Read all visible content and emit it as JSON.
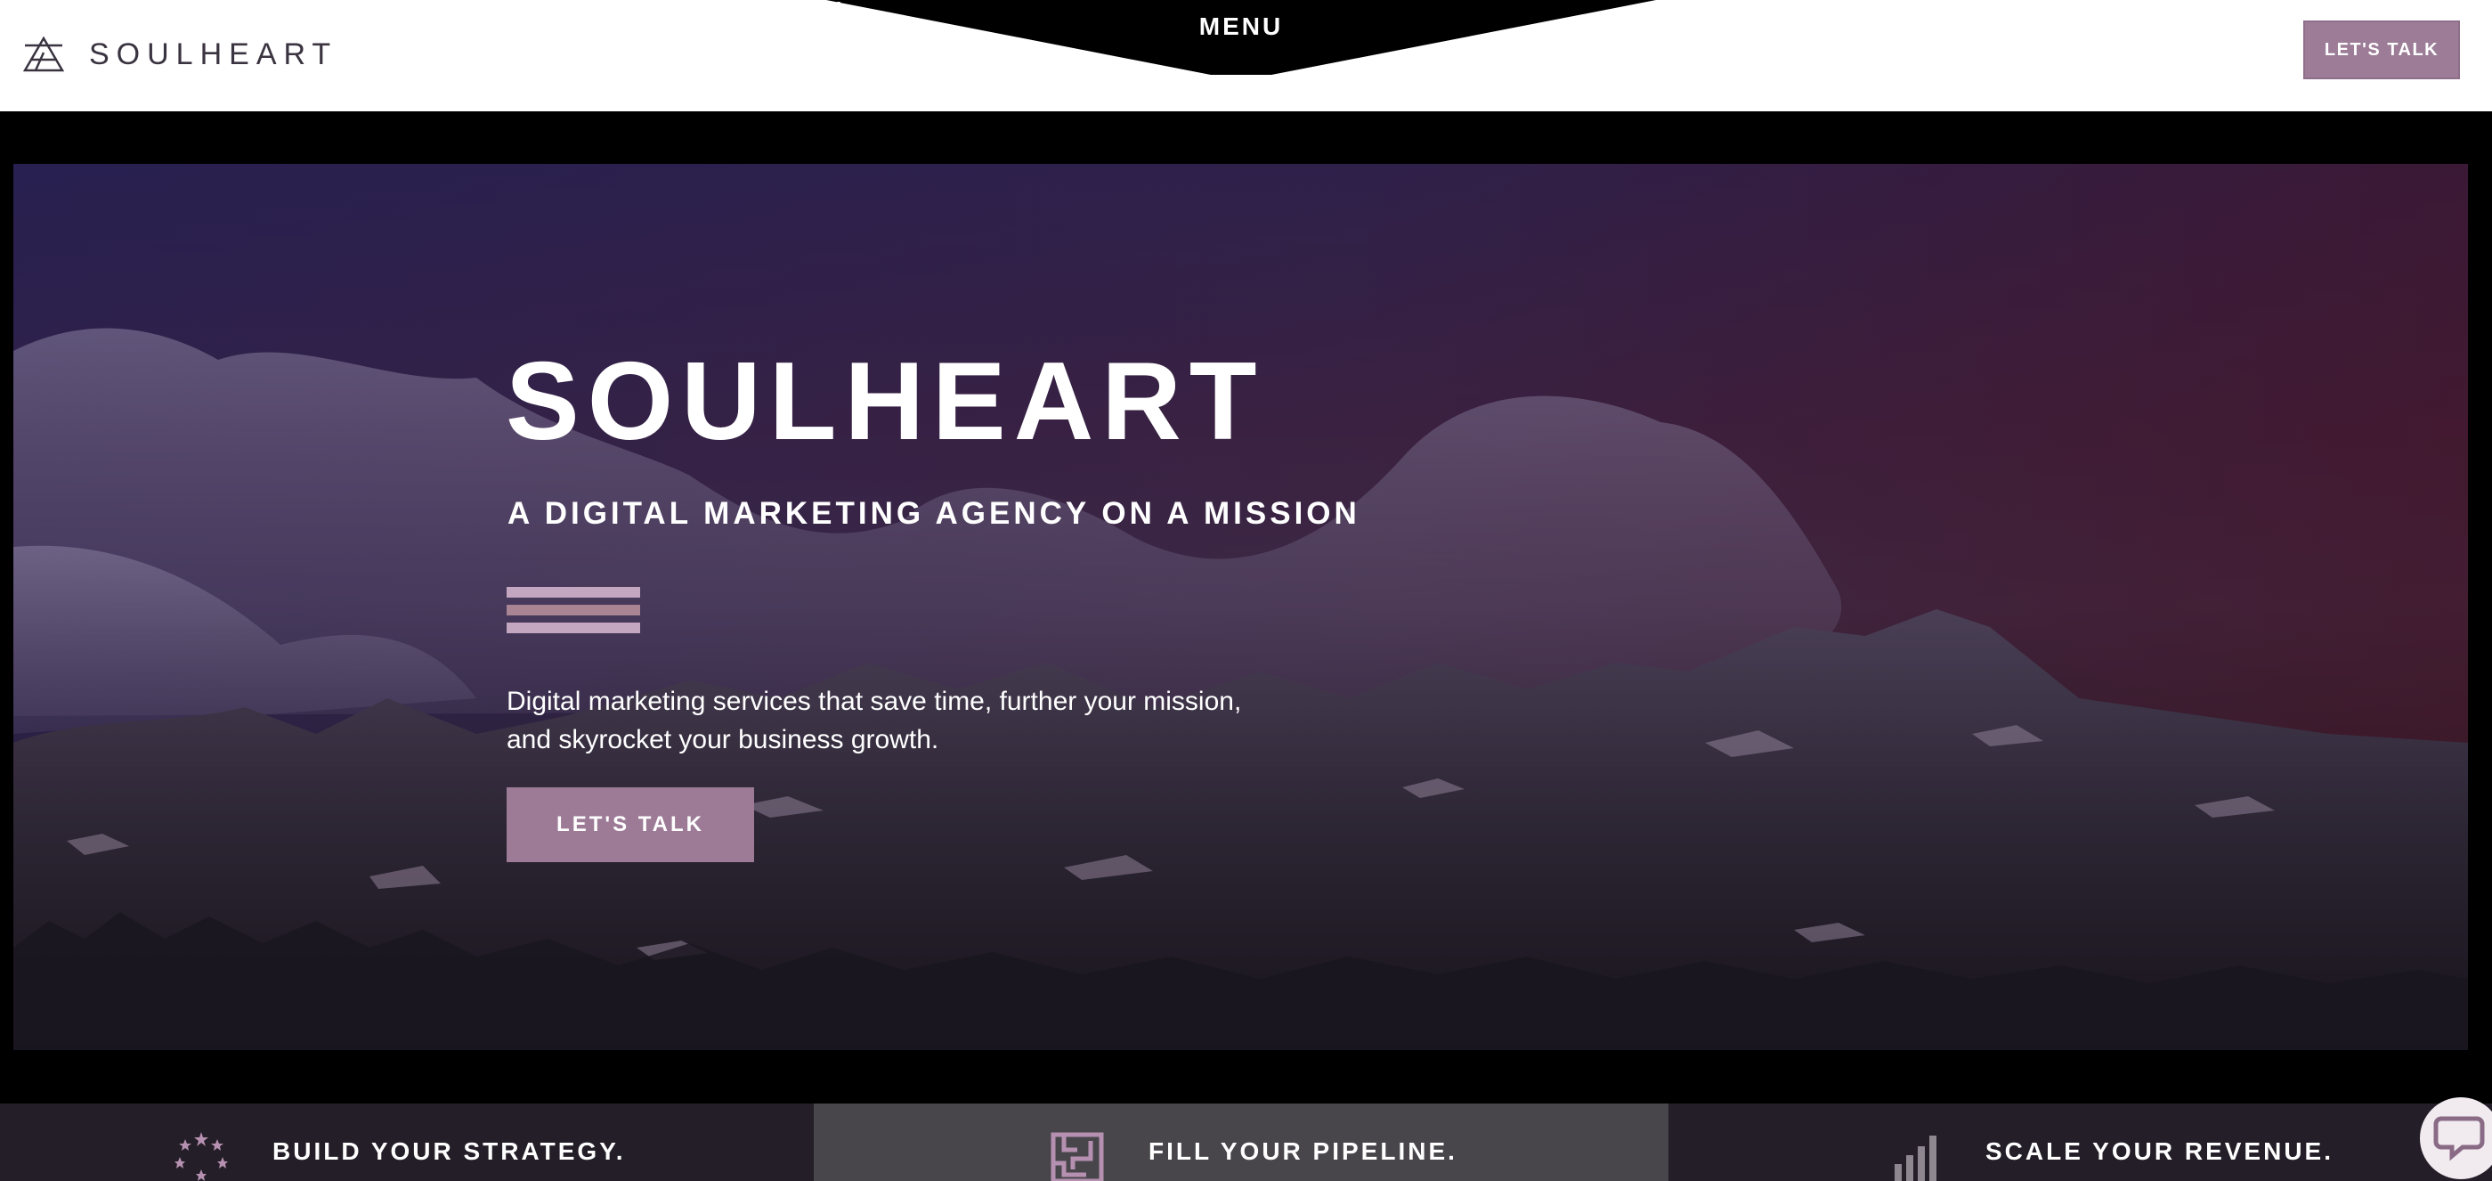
{
  "header": {
    "logo_text": "SOULHEART",
    "menu_label": "MENU",
    "cta_label": "LET'S TALK"
  },
  "hero": {
    "title": "SOULHEART",
    "subtitle": "A DIGITAL MARKETING AGENCY ON A MISSION",
    "description_line1": "Digital marketing services that save time, further your mission,",
    "description_line2": "and skyrocket your business growth.",
    "cta_label": "LET'S TALK"
  },
  "features": [
    {
      "label": "BUILD YOUR STRATEGY.",
      "icon": "star-circle-icon"
    },
    {
      "label": "FILL YOUR PIPELINE.",
      "icon": "maze-icon"
    },
    {
      "label": "SCALE YOUR REVENUE.",
      "icon": "bar-chart-icon"
    }
  ],
  "colors": {
    "accent": "#9d7b96",
    "bar_light": "#c3a6c0",
    "bar_mid": "#a98492",
    "feature_dark": "#231e27",
    "feature_mid": "#48464b",
    "logo_dark": "#3a3340"
  },
  "chat": {
    "icon": "chat-icon"
  }
}
